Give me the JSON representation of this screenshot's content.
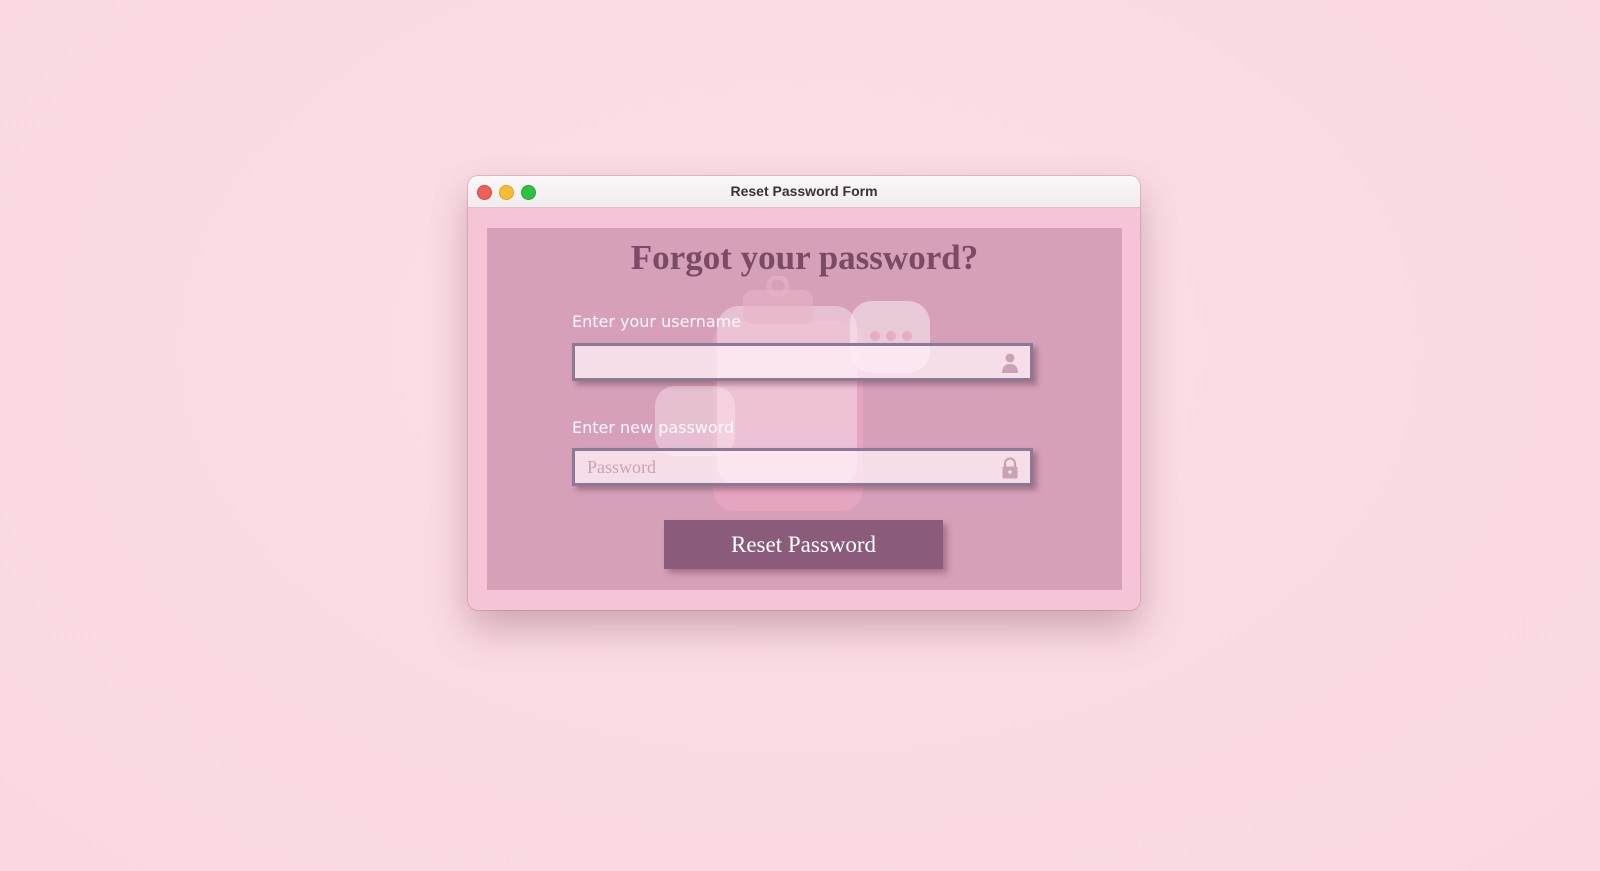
{
  "window": {
    "title": "Reset Password Form"
  },
  "form": {
    "heading": "Forgot your password?",
    "username": {
      "label": "Enter your username",
      "value": "",
      "placeholder": "",
      "icon": "user-icon"
    },
    "password": {
      "label": "Enter new password",
      "value": "",
      "placeholder": "Password",
      "icon": "lock-icon"
    },
    "submit_label": "Reset Password"
  },
  "colors": {
    "desktop_background": "#fbdbe3",
    "window_frame": "#f7c3d7",
    "content_panel": "#d5a0b8",
    "heading": "#7b4a66",
    "button": "#8a5b7b",
    "input_border": "#8a7a98"
  }
}
